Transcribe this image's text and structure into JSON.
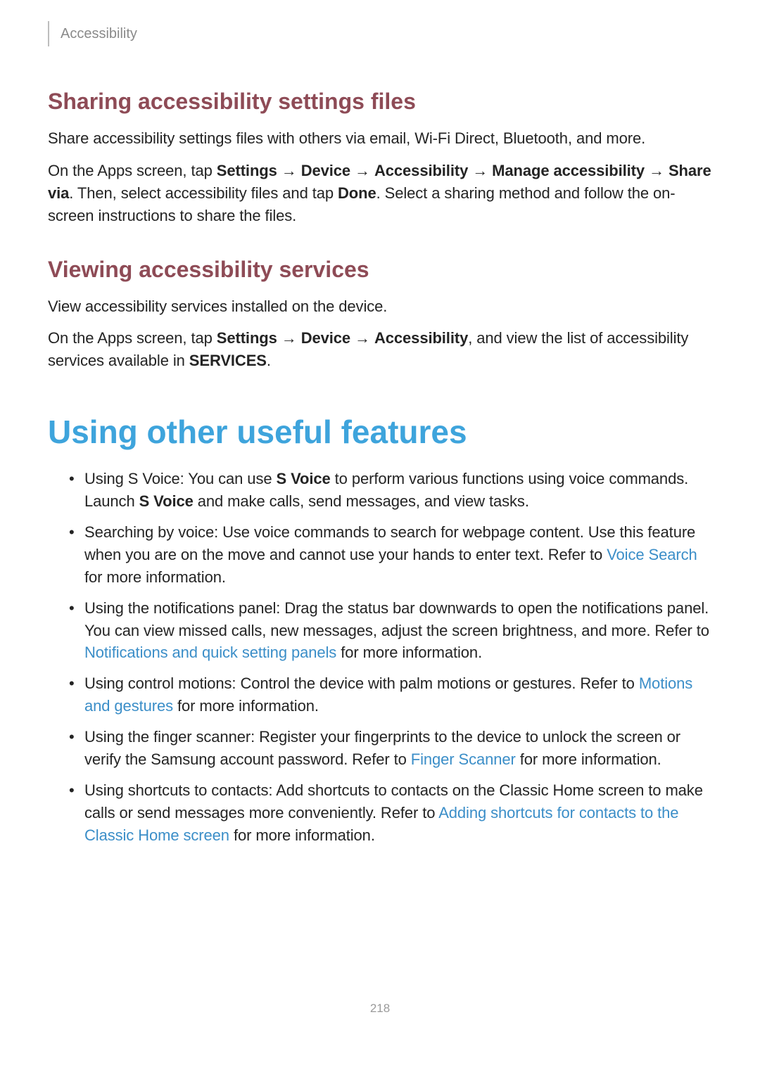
{
  "header": {
    "breadcrumb": "Accessibility"
  },
  "section1": {
    "title": "Sharing accessibility settings files",
    "p1": "Share accessibility settings files with others via email, Wi-Fi Direct, Bluetooth, and more.",
    "p2_a": "On the Apps screen, tap ",
    "p2_b": "Settings",
    "p2_c": " → ",
    "p2_d": "Device",
    "p2_e": " → ",
    "p2_f": "Accessibility",
    "p2_g": " → ",
    "p2_h": "Manage accessibility",
    "p2_i": " → ",
    "p2_j": "Share via",
    "p2_k": ". Then, select accessibility files and tap ",
    "p2_l": "Done",
    "p2_m": ". Select a sharing method and follow the on-screen instructions to share the files."
  },
  "section2": {
    "title": "Viewing accessibility services",
    "p1": "View accessibility services installed on the device.",
    "p2_a": "On the Apps screen, tap ",
    "p2_b": "Settings",
    "p2_c": " → ",
    "p2_d": "Device",
    "p2_e": " → ",
    "p2_f": "Accessibility",
    "p2_g": ", and view the list of accessibility services available in ",
    "p2_h": "SERVICES",
    "p2_i": "."
  },
  "section3": {
    "title": "Using other useful features",
    "items": [
      {
        "runs": [
          {
            "t": "Using S Voice: You can use "
          },
          {
            "t": "S Voice",
            "bold": true
          },
          {
            "t": " to perform various functions using voice commands. Launch "
          },
          {
            "t": "S Voice",
            "bold": true
          },
          {
            "t": " and make calls, send messages, and view tasks."
          }
        ]
      },
      {
        "runs": [
          {
            "t": "Searching by voice: Use voice commands to search for webpage content. Use this feature when you are on the move and cannot use your hands to enter text. Refer to "
          },
          {
            "t": "Voice Search",
            "link": true
          },
          {
            "t": " for more information."
          }
        ]
      },
      {
        "runs": [
          {
            "t": "Using the notifications panel: Drag the status bar downwards to open the notifications panel. You can view missed calls, new messages, adjust the screen brightness, and more. Refer to "
          },
          {
            "t": "Notifications and quick setting panels",
            "link": true
          },
          {
            "t": " for more information."
          }
        ]
      },
      {
        "runs": [
          {
            "t": "Using control motions: Control the device with palm motions or gestures. Refer to "
          },
          {
            "t": "Motions and gestures",
            "link": true
          },
          {
            "t": " for more information."
          }
        ]
      },
      {
        "runs": [
          {
            "t": "Using the finger scanner: Register your fingerprints to the device to unlock the screen or verify the Samsung account password. Refer to "
          },
          {
            "t": "Finger Scanner",
            "link": true
          },
          {
            "t": " for more information."
          }
        ]
      },
      {
        "runs": [
          {
            "t": "Using shortcuts to contacts: Add shortcuts to contacts on the Classic Home screen to make calls or send messages more conveniently. Refer to "
          },
          {
            "t": "Adding shortcuts for contacts to the Classic Home screen",
            "link": true
          },
          {
            "t": " for more information."
          }
        ]
      }
    ]
  },
  "page_number": "218"
}
